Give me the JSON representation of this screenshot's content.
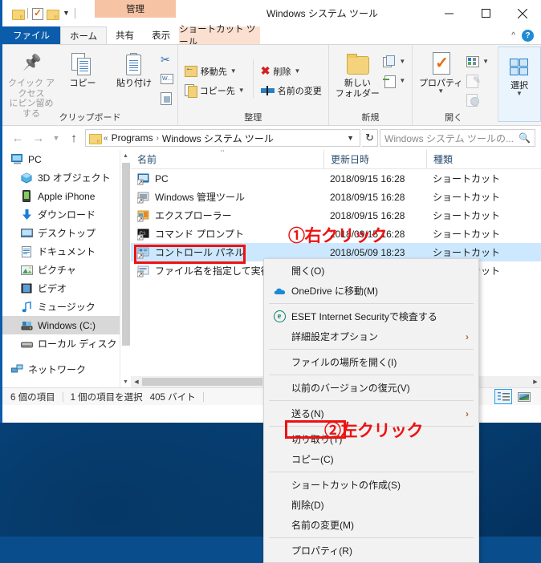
{
  "window": {
    "title": "Windows システム ツール",
    "contextual_tab_group": "管理",
    "quick_access": [
      "folder-icon",
      "properties-icon",
      "new-folder-icon",
      "customize-dropdown-icon"
    ],
    "controls": {
      "minimize": "–",
      "maximize": "☐",
      "close": "✕"
    }
  },
  "tabs": [
    {
      "label": "ファイル",
      "state": "file"
    },
    {
      "label": "ホーム",
      "state": "active"
    },
    {
      "label": "共有",
      "state": "normal"
    },
    {
      "label": "表示",
      "state": "normal"
    },
    {
      "label": "ショートカット ツール",
      "state": "contextual"
    }
  ],
  "ribbon": {
    "collapse_icon": "chevron-up-icon",
    "help_icon": "help-icon",
    "groups": [
      {
        "label": "クリップボード",
        "big_buttons": [
          {
            "label": "クイック アクセス\nにピン留めする",
            "label_line1": "クイック アクセス",
            "label_line2": "にピン留めする",
            "icon": "pin-icon",
            "disabled": true
          },
          {
            "label": "コピー",
            "icon": "copy-icon",
            "disabled": false
          },
          {
            "label": "貼り付け",
            "icon": "paste-icon",
            "disabled": false
          }
        ],
        "small_buttons": [
          {
            "label": "",
            "icon": "scissors-icon"
          },
          {
            "label": "",
            "icon": "copy-path-icon"
          },
          {
            "label": "",
            "icon": "paste-shortcut-icon"
          }
        ]
      },
      {
        "label": "整理",
        "small_buttons": [
          {
            "label": "移動先",
            "icon": "move-to-icon",
            "dropdown": true
          },
          {
            "label": "削除",
            "icon": "delete-icon",
            "dropdown": true
          },
          {
            "label": "コピー先",
            "icon": "copy-to-icon",
            "dropdown": true
          },
          {
            "label": "名前の変更",
            "icon": "rename-icon",
            "dropdown": false
          }
        ]
      },
      {
        "label": "新規",
        "big_buttons": [
          {
            "label_line1": "新しい",
            "label_line2": "フォルダー",
            "icon": "new-folder-icon"
          }
        ],
        "small_buttons": [
          {
            "label": "",
            "icon": "new-item-icon",
            "dropdown": true
          },
          {
            "label": "",
            "icon": "easy-access-icon",
            "dropdown": true
          }
        ]
      },
      {
        "label": "開く",
        "big_buttons": [
          {
            "label": "プロパティ",
            "icon": "properties-icon",
            "dropdown": true
          }
        ],
        "small_buttons": [
          {
            "label": "",
            "icon": "open-icon",
            "dropdown": true
          },
          {
            "label": "",
            "icon": "edit-icon",
            "disabled": true
          },
          {
            "label": "",
            "icon": "history-icon",
            "disabled": true
          }
        ]
      },
      {
        "label": "",
        "big_buttons": [
          {
            "label": "選択",
            "icon": "select-icon",
            "dropdown": true
          }
        ]
      }
    ]
  },
  "addressbar": {
    "back": "←",
    "forward": "→",
    "recent": "⌄",
    "up": "↑",
    "folder_icon": "folder-icon",
    "crumb_prefix": "«",
    "crumbs": [
      "Programs",
      "Windows システム ツール"
    ],
    "crumb_sep": "›",
    "dropdown": "⌄",
    "refresh": "↻",
    "search_placeholder": "Windows システム ツールの...",
    "search_icon": "search-icon"
  },
  "navpane": {
    "items": [
      {
        "label": "PC",
        "icon": "pc-icon",
        "level": 1,
        "selected": false
      },
      {
        "label": "3D オブジェクト",
        "icon": "3d-objects-icon",
        "level": 2,
        "selected": false
      },
      {
        "label": "Apple iPhone",
        "icon": "phone-icon",
        "level": 2,
        "selected": false
      },
      {
        "label": "ダウンロード",
        "icon": "downloads-icon",
        "level": 2,
        "selected": false
      },
      {
        "label": "デスクトップ",
        "icon": "desktop-icon",
        "level": 2,
        "selected": false
      },
      {
        "label": "ドキュメント",
        "icon": "documents-icon",
        "level": 2,
        "selected": false
      },
      {
        "label": "ピクチャ",
        "icon": "pictures-icon",
        "level": 2,
        "selected": false
      },
      {
        "label": "ビデオ",
        "icon": "videos-icon",
        "level": 2,
        "selected": false
      },
      {
        "label": "ミュージック",
        "icon": "music-icon",
        "level": 2,
        "selected": false
      },
      {
        "label": "Windows (C:)",
        "icon": "drive-icon",
        "level": 2,
        "selected": true
      },
      {
        "label": "ローカル ディスク (D",
        "icon": "drive-icon",
        "level": 2,
        "selected": false
      },
      {
        "label": "ネットワーク",
        "icon": "network-icon",
        "level": 1,
        "selected": false
      }
    ]
  },
  "filelist": {
    "columns": [
      {
        "label": "名前",
        "sorted": true
      },
      {
        "label": "更新日時",
        "sorted": false
      },
      {
        "label": "種類",
        "sorted": false
      }
    ],
    "rows": [
      {
        "name": "PC",
        "date": "2018/09/15 16:28",
        "type": "ショートカット",
        "selected": false
      },
      {
        "name": "Windows 管理ツール",
        "date": "2018/09/15 16:28",
        "type": "ショートカット",
        "selected": false
      },
      {
        "name": "エクスプローラー",
        "date": "2018/09/15 16:28",
        "type": "ショートカット",
        "selected": false
      },
      {
        "name": "コマンド プロンプト",
        "date": "2018/09/15 16:28",
        "type": "ショートカット",
        "selected": false
      },
      {
        "name": "コントロール パネル",
        "date": "2018/05/09 18:23",
        "type": "ショートカット",
        "selected": true
      },
      {
        "name": "ファイル名を指定して実行",
        "date": "",
        "type": "ショートカット",
        "selected": false
      }
    ]
  },
  "statusbar": {
    "count": "6 個の項目",
    "selection": "1 個の項目を選択",
    "size": "405 バイト",
    "view_buttons": [
      {
        "name": "details-view",
        "icon": "details-view-icon",
        "active": true
      },
      {
        "name": "large-icons-view",
        "icon": "tiles-view-icon",
        "active": false
      }
    ]
  },
  "contextmenu": {
    "items": [
      {
        "label": "開く(O)",
        "icon": null,
        "submenu": false,
        "sep_after": false
      },
      {
        "label": "OneDrive に移動(M)",
        "icon": "onedrive-icon",
        "submenu": false,
        "sep_after": true
      },
      {
        "label": "ESET Internet Securityで検査する",
        "icon": "eset-icon",
        "submenu": false,
        "sep_after": false
      },
      {
        "label": "詳細設定オプション",
        "icon": null,
        "submenu": true,
        "sep_after": true
      },
      {
        "label": "ファイルの場所を開く(I)",
        "icon": null,
        "submenu": false,
        "sep_after": true
      },
      {
        "label": "以前のバージョンの復元(V)",
        "icon": null,
        "submenu": false,
        "sep_after": true
      },
      {
        "label": "送る(N)",
        "icon": null,
        "submenu": true,
        "sep_after": true
      },
      {
        "label": "切り取り(T)",
        "icon": null,
        "submenu": false,
        "sep_after": false
      },
      {
        "label": "コピー(C)",
        "icon": null,
        "submenu": false,
        "sep_after": true,
        "highlighted": true
      },
      {
        "label": "ショートカットの作成(S)",
        "icon": null,
        "submenu": false,
        "sep_after": false
      },
      {
        "label": "削除(D)",
        "icon": null,
        "submenu": false,
        "sep_after": false
      },
      {
        "label": "名前の変更(M)",
        "icon": null,
        "submenu": false,
        "sep_after": true
      },
      {
        "label": "プロパティ(R)",
        "icon": null,
        "submenu": false,
        "sep_after": false
      }
    ]
  },
  "annotations": [
    {
      "id": "annot1",
      "text": "①右クリック",
      "color": "#ee1111",
      "target": "コントロール パネル"
    },
    {
      "id": "annot2",
      "text": "②左クリック",
      "color": "#ee1111",
      "target": "コピー(C)"
    }
  ]
}
